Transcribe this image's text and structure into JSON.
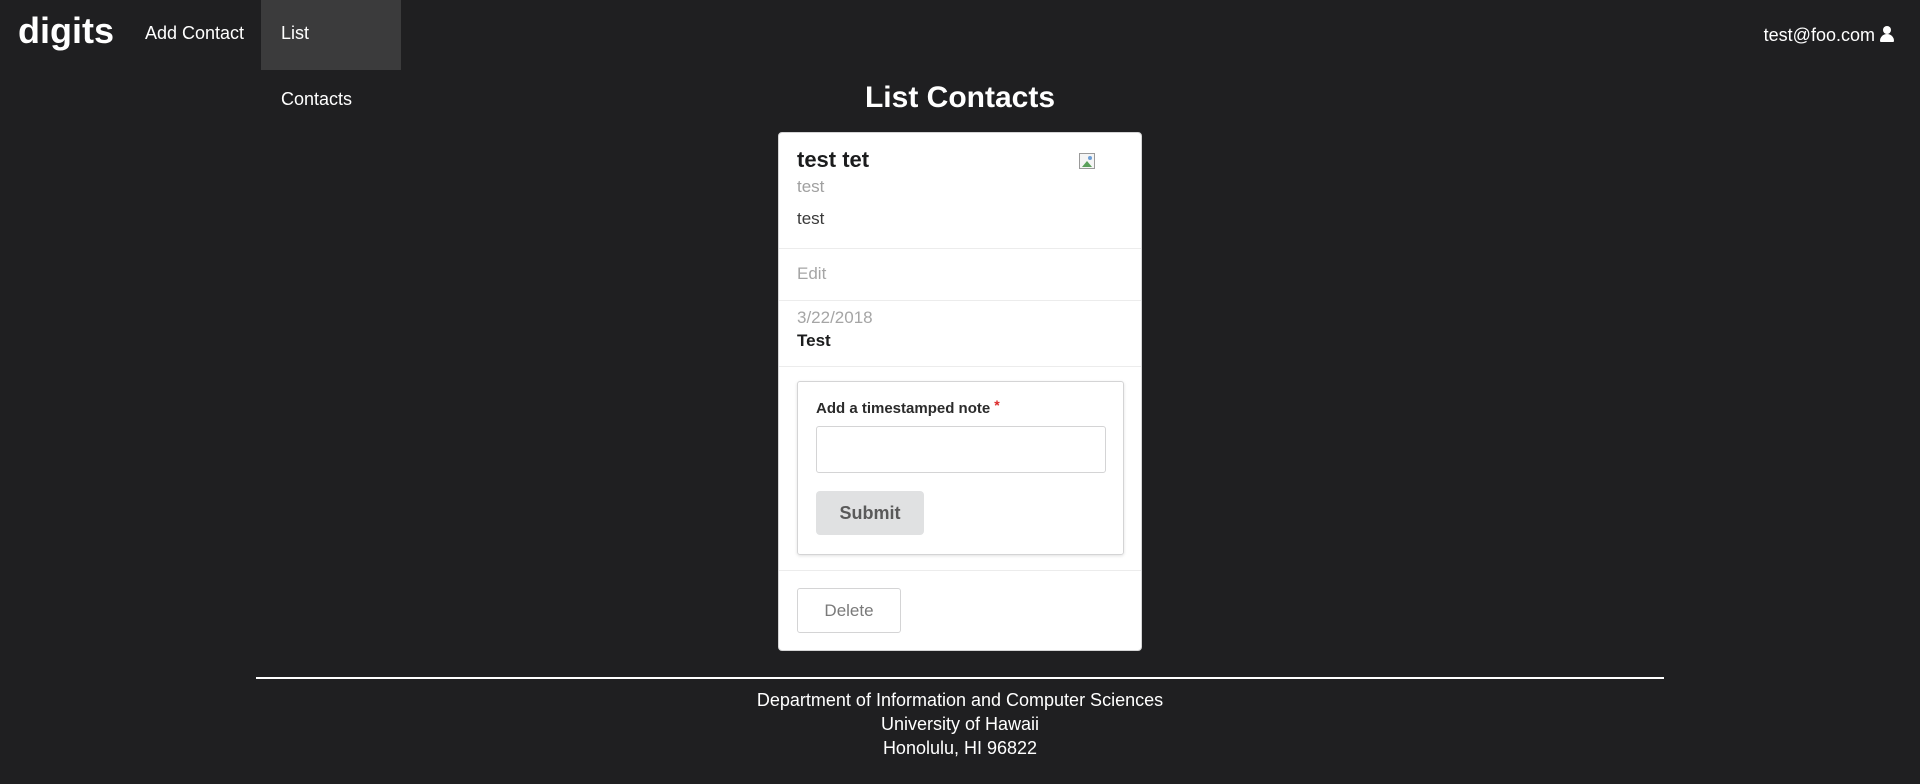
{
  "navbar": {
    "brand": "digits",
    "items": [
      {
        "label": "Add Contact",
        "active": false
      },
      {
        "label": "List Contacts",
        "active": true
      }
    ],
    "user_email": "test@foo.com",
    "user_icon": "user-icon"
  },
  "page": {
    "title": "List Contacts"
  },
  "contact_card": {
    "name": "test tet",
    "meta": "test",
    "description": "test",
    "image_icon": "broken-image-icon",
    "edit_label": "Edit",
    "notes": [
      {
        "date": "3/22/2018",
        "text": "Test"
      }
    ],
    "note_form": {
      "label": "Add a timestamped note",
      "required_marker": "*",
      "input_value": "",
      "submit_label": "Submit"
    },
    "delete_label": "Delete"
  },
  "footer": {
    "lines": [
      "Department of Information and Computer Sciences",
      "University of Hawaii",
      "Honolulu, HI 96822"
    ]
  },
  "colors": {
    "background": "#1f1f21",
    "active_nav": "#3b3b3c",
    "card": "#ffffff",
    "required": "#db2828",
    "button_gray": "#e0e1e2"
  }
}
